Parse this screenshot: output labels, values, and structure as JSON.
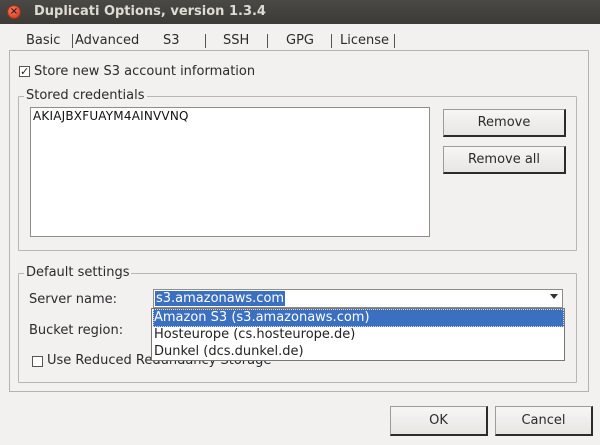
{
  "window": {
    "title": "Duplicati Options, version 1.3.4"
  },
  "tabs": [
    "Basic",
    "Advanced",
    "S3",
    "SSH",
    "GPG",
    "License"
  ],
  "store_checkbox": {
    "label": "Store new S3 account information",
    "checked": true
  },
  "stored_credentials": {
    "legend": "Stored credentials",
    "items": [
      "AKIAJBXFUAYM4AINVVNQ"
    ],
    "remove_label": "Remove",
    "remove_all_label": "Remove all"
  },
  "default_settings": {
    "legend": "Default settings",
    "server_name_label": "Server name:",
    "server_name_value": "s3.amazonaws.com",
    "bucket_region_label": "Bucket region:",
    "reduced_redundancy_label": "Use Reduced Redundancy Storage",
    "reduced_redundancy_checked": false,
    "dropdown_options": [
      "Amazon S3 (s3.amazonaws.com)",
      "Hosteurope (cs.hosteurope.de)",
      "Dunkel (dcs.dunkel.de)"
    ]
  },
  "footer": {
    "ok_label": "OK",
    "cancel_label": "Cancel"
  },
  "colors": {
    "selection": "#3b6fbf",
    "titlebar": "#3c3b37",
    "close": "#d9472b"
  }
}
